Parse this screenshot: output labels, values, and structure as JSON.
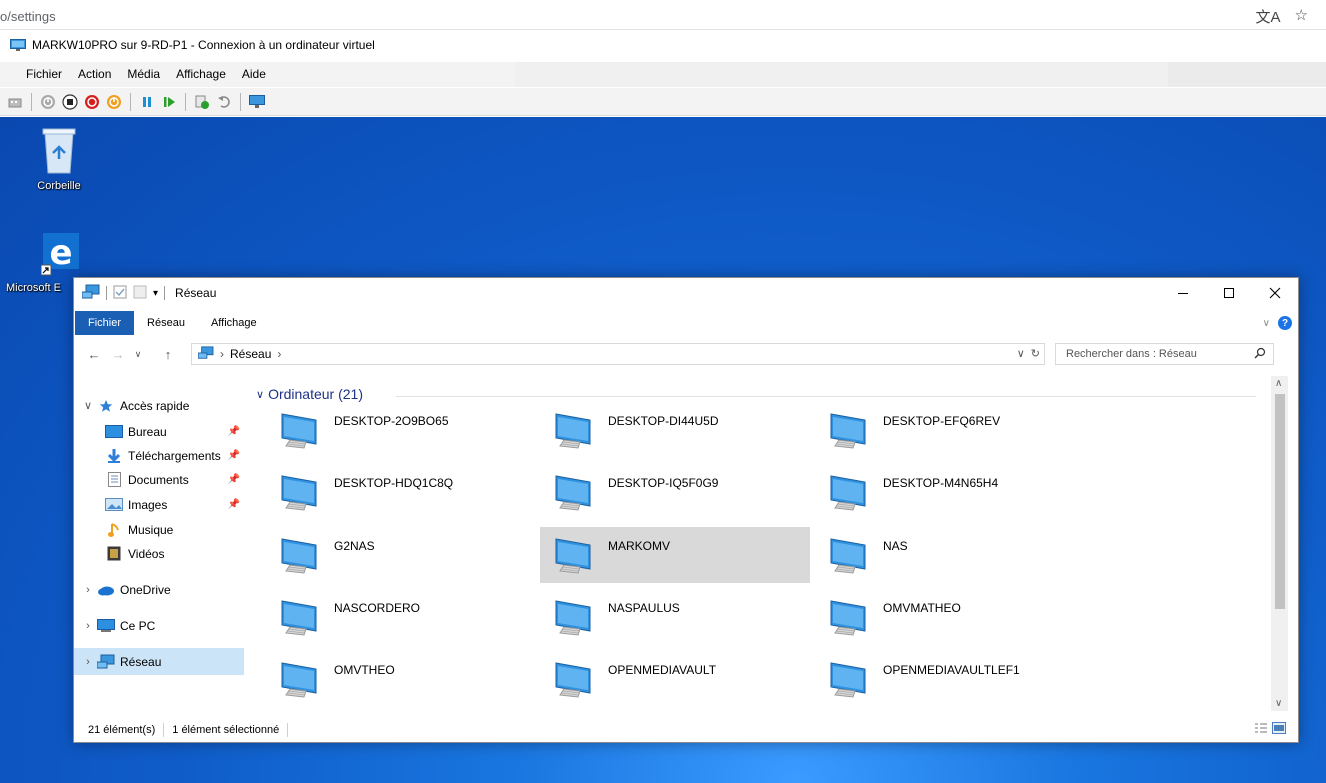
{
  "browser": {
    "url": "o/settings",
    "translate_icon": "translate-icon",
    "star_icon": "star-icon"
  },
  "vm": {
    "title": "MARKW10PRO sur 9-RD-P1 - Connexion à un ordinateur virtuel",
    "menu": [
      "Fichier",
      "Action",
      "Média",
      "Affichage",
      "Aide"
    ],
    "toolbar": [
      "ctrl-alt-del-icon",
      "start-icon",
      "turn-off-icon",
      "shutdown-icon",
      "save-state-icon",
      "pause-icon",
      "resume-icon",
      "checkpoint-icon",
      "revert-icon",
      "enhanced-session-icon"
    ]
  },
  "desktop": {
    "icons": [
      {
        "label": "Corbeille",
        "icon": "recycle-bin-icon"
      },
      {
        "label": "Microsoft E",
        "icon": "edge-icon"
      }
    ]
  },
  "explorer": {
    "title": "Réseau",
    "tabs": [
      "Fichier",
      "Réseau",
      "Affichage"
    ],
    "address": {
      "location": "Réseau"
    },
    "search_placeholder": "Rechercher dans : Réseau",
    "nav": {
      "quick_access": "Accès rapide",
      "quick_items": [
        "Bureau",
        "Téléchargements",
        "Documents",
        "Images",
        "Musique",
        "Vidéos"
      ],
      "onedrive": "OneDrive",
      "this_pc": "Ce PC",
      "network": "Réseau"
    },
    "group": "Ordinateur (21)",
    "computers": [
      "DESKTOP-2O9BO65",
      "DESKTOP-DI44U5D",
      "DESKTOP-EFQ6REV",
      "DESKTOP-HDQ1C8Q",
      "DESKTOP-IQ5F0G9",
      "DESKTOP-M4N65H4",
      "G2NAS",
      "MARKOMV",
      "NAS",
      "NASCORDERO",
      "NASPAULUS",
      "OMVMATHEO",
      "OMVTHEO",
      "OPENMEDIAVAULT",
      "OPENMEDIAVAULTLEF1"
    ],
    "selected_computer": "MARKOMV",
    "status": {
      "count": "21 élément(s)",
      "selected": "1 élément sélectionné"
    }
  }
}
